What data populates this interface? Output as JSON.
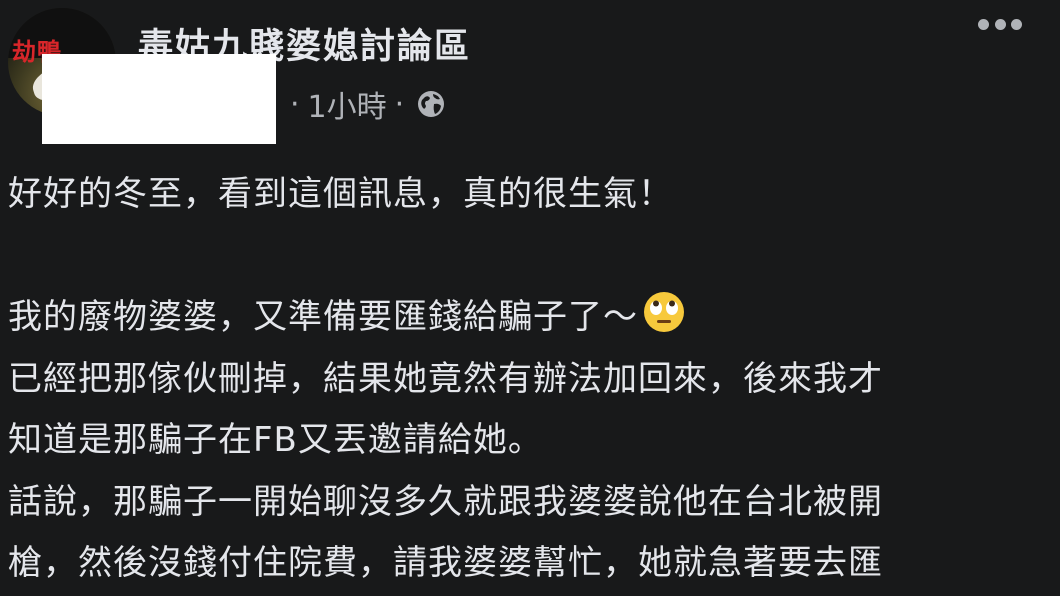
{
  "post": {
    "group_name": "毒姑九賤婆媳討論區",
    "avatar_text": "劫鴨",
    "timestamp": "1小時",
    "meta_separator": "·",
    "privacy_icon": "globe-icon",
    "more_icon": "more-options-icon",
    "lines": [
      "好好的冬至，看到這個訊息，真的很生氣！",
      "",
      "我的廢物婆婆，又準備要匯錢給騙子了～",
      "已經把那傢伙刪掉，結果她竟然有辦法加回來，後來我才",
      "知道是那騙子在FB又丟邀請給她。",
      "話說，那騙子一開始聊沒多久就跟我婆婆說他在台北被開",
      "槍，然後沒錢付住院費，請我婆婆幫忙，她就急著要去匯"
    ],
    "emoji": "face-with-rolling-eyes-emoji"
  },
  "colors": {
    "background": "#18191a",
    "primary_text": "#e4e6eb",
    "secondary_text": "#b0b3b8",
    "redaction": "#ffffff"
  }
}
